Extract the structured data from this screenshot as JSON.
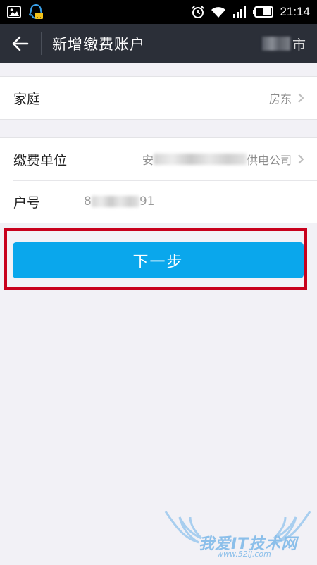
{
  "status_bar": {
    "time": "21:14",
    "icons": [
      "gallery-icon",
      "qq-icon",
      "alarm-icon",
      "wifi-icon",
      "signal-icon",
      "battery-icon"
    ],
    "battery_level": 0.55
  },
  "header": {
    "back_icon": "back-arrow-icon",
    "title": "新增缴费账户",
    "city_suffix": "市"
  },
  "form": {
    "group1": {
      "label": "家庭",
      "value": "房东"
    },
    "group2": {
      "unit_label": "缴费单位",
      "unit_prefix": "安",
      "unit_suffix": "供电公司",
      "account_label": "户号",
      "account_prefix": "8",
      "account_suffix": "91"
    }
  },
  "next_button": {
    "label": "下一步"
  },
  "colors": {
    "header_bg": "#2b2f38",
    "button_bg": "#0aa7ec",
    "highlight": "#c8001c",
    "page_bg": "#f2f1f6"
  },
  "watermark": {
    "text": "我爱IT技术网",
    "url": "www.52ij.com"
  }
}
